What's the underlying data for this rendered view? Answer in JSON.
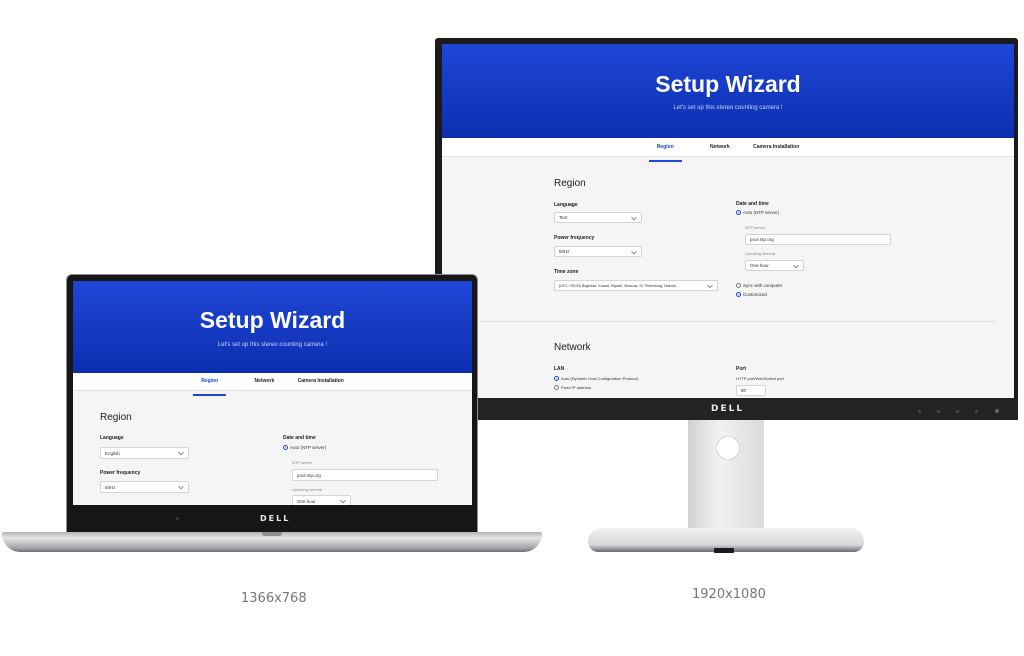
{
  "wizard": {
    "title": "Setup Wizard",
    "subtitle": "Let's set up this stereo counting camera !",
    "tabs": [
      "Region",
      "Network",
      "Camera Installation"
    ],
    "region": {
      "heading": "Region",
      "language_label": "Language",
      "language_value_monitor": "Text",
      "language_value_laptop": "English",
      "power_label": "Power frequency",
      "power_value": "50Hz",
      "timezone_label": "Time zone",
      "timezone_value": "(UTC +03:00) Baghdad, Kuwait, Riyadh, Moscow, St. Petersburg, Nairobi...",
      "datetime_label": "Date and time",
      "auto_ntp": "Auto (NTP server)",
      "ntp_label": "NTP server",
      "ntp_value": "pool.ntp.org",
      "interval_label": "Updating interval",
      "interval_value": "One hour",
      "sync_computer": "Sync with computer",
      "customized": "Customized"
    },
    "network": {
      "heading": "Network",
      "lan_label": "LAN",
      "dhcp": "Auto (Dynamic Host Configuration Protocol)",
      "fixed_ip": "Fixed IP address",
      "port_label": "Port",
      "http_port_label": "HTTP port/WebSocket port",
      "http_port_value": "80"
    }
  },
  "brand": {
    "logo": "DELL"
  },
  "captions": {
    "laptop": "1366x768",
    "monitor": "1920x1080"
  },
  "colors": {
    "accent": "#1f46d6",
    "hero_top": "#1f46d6",
    "hero_bottom": "#0c2fb0",
    "panel_bg": "#f5f5f6"
  }
}
